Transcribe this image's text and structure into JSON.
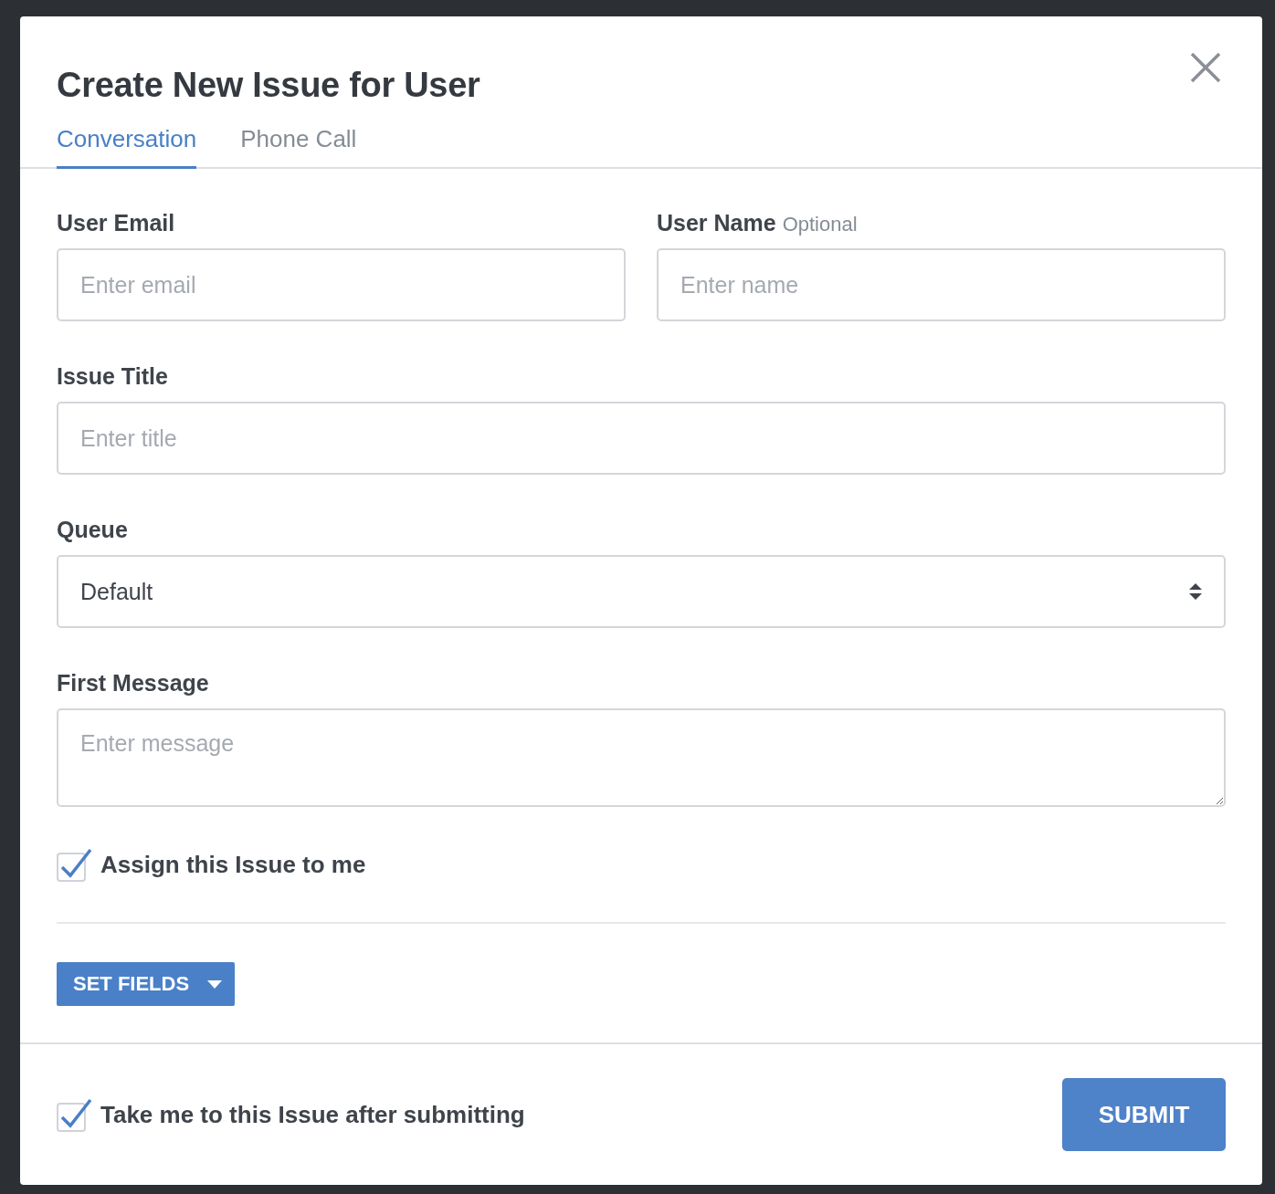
{
  "dialog": {
    "title": "Create New Issue for User"
  },
  "tabs": [
    {
      "label": "Conversation",
      "selected": true
    },
    {
      "label": "Phone Call",
      "selected": false
    }
  ],
  "rows": [
    [
      {
        "kind": "input",
        "label": "User Email",
        "placeholder": "Enter email"
      },
      {
        "kind": "input",
        "label": "User Name",
        "hint": "Optional",
        "placeholder": "Enter name"
      }
    ],
    [
      {
        "kind": "input",
        "label": "Issue Title",
        "placeholder": "Enter title"
      }
    ],
    [
      {
        "kind": "select",
        "label": "Queue",
        "value": "Default"
      }
    ],
    [
      {
        "kind": "textarea",
        "label": "First Message",
        "placeholder": "Enter message"
      }
    ]
  ],
  "assign_checkbox": {
    "label": "Assign this Issue to me",
    "checked": true
  },
  "set_fields_button": {
    "label": "SET FIELDS"
  },
  "footer": {
    "redirect_checkbox": {
      "label": "Take me to this Issue after submitting",
      "checked": true
    },
    "submit_button": {
      "label": "SUBMIT"
    }
  }
}
